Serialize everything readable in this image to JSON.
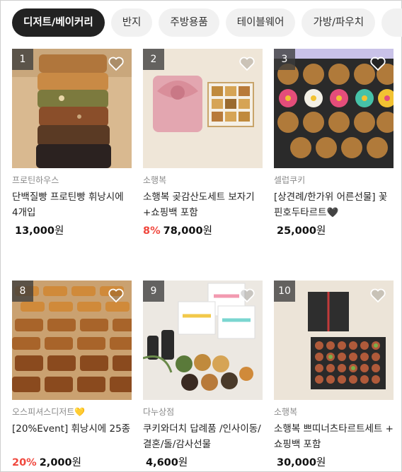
{
  "tabs": [
    {
      "label": "디저트/베이커리",
      "active": true
    },
    {
      "label": "반지",
      "active": false
    },
    {
      "label": "주방용품",
      "active": false
    },
    {
      "label": "테이블웨어",
      "active": false
    },
    {
      "label": "가방/파우치",
      "active": false
    }
  ],
  "products": [
    {
      "rank": "1",
      "brand": "프로틴하우스",
      "name": "단백질빵 프로틴빵 휘낭시에 4개입",
      "discount": "",
      "price": "13,000",
      "currency": "원",
      "image": "financier-stack"
    },
    {
      "rank": "2",
      "brand": "소행복",
      "name": "소행복 곶감산도세트 보자기+쇼핑백 포함",
      "discount": "8%",
      "price": "78,000",
      "currency": "원",
      "image": "gift-box-wrap"
    },
    {
      "rank": "3",
      "brand": "셀럽쿠키",
      "name": "[상견례/한가위 어른선물] 꽃핀호두타르트🖤",
      "discount": "",
      "price": "25,000",
      "currency": "원",
      "image": "flower-tarts"
    },
    {
      "rank": "8",
      "brand": "오스피셔스디저트💛",
      "name": "[20%Event] 휘낭시에 25종",
      "discount": "20%",
      "price": "2,000",
      "currency": "원",
      "image": "financier-tray"
    },
    {
      "rank": "9",
      "brand": "다누상점",
      "name": "쿠키와더치 답례품 /인사이동/결혼/돌/감사선물",
      "discount": "",
      "price": "4,600",
      "currency": "원",
      "image": "cookie-gifts"
    },
    {
      "rank": "10",
      "brand": "소행복",
      "name": "소행복 쁘띠너츠타르트세트 + 쇼핑백 포함",
      "discount": "",
      "price": "30,000",
      "currency": "원",
      "image": "tart-box"
    }
  ],
  "icons": {
    "wishlist": "heart-outline-icon"
  },
  "colors": {
    "active_tab": "#222222",
    "tab": "#f1f1f1",
    "discount": "#f0483e",
    "brand_text": "#8a8a8a"
  }
}
